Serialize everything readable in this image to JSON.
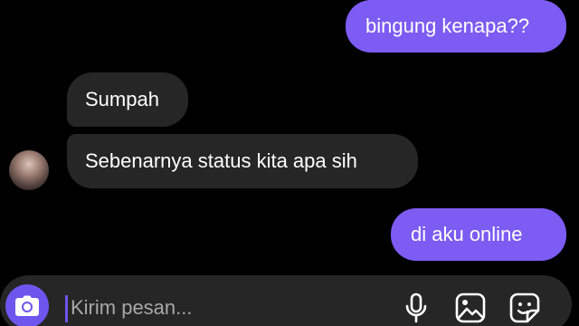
{
  "conversation": {
    "messages": [
      {
        "direction": "outgoing",
        "text": "bingung kenapa??"
      },
      {
        "direction": "incoming",
        "text": "Sumpah"
      },
      {
        "direction": "incoming",
        "text": "Sebenarnya status kita apa sih"
      },
      {
        "direction": "outgoing",
        "text": "di aku online"
      }
    ]
  },
  "composer": {
    "placeholder": "Kirim pesan...",
    "value": "",
    "icons": {
      "camera": "camera-icon",
      "mic": "microphone-icon",
      "gallery": "gallery-icon",
      "sticker": "sticker-icon"
    }
  },
  "colors": {
    "background": "#000000",
    "outgoing_bubble": "#7c5cf2",
    "incoming_bubble": "#262626",
    "accent": "#6d55ee"
  }
}
